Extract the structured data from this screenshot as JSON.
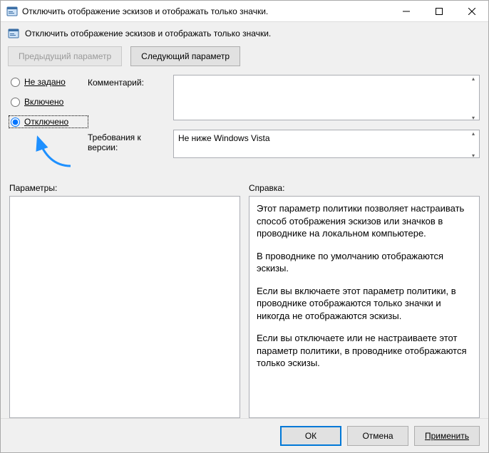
{
  "window": {
    "title": "Отключить отображение эскизов и отображать только значки."
  },
  "header": {
    "subtitle": "Отключить отображение эскизов и отображать только значки."
  },
  "nav": {
    "prev": "Предыдущий параметр",
    "next": "Следующий параметр"
  },
  "radios": {
    "not_configured": "Не задано",
    "enabled": "Включено",
    "disabled": "Отключено",
    "selected": "disabled"
  },
  "fields": {
    "comment_label": "Комментарий:",
    "comment_value": "",
    "requirements_label": "Требования к версии:",
    "requirements_value": "Не ниже Windows Vista"
  },
  "columns": {
    "options_label": "Параметры:",
    "help_label": "Справка:"
  },
  "help_paragraphs": [
    "Этот параметр политики позволяет настраивать способ отображения эскизов или значков в проводнике на локальном компьютере.",
    "В проводнике по умолчанию отображаются эскизы.",
    "Если вы включаете этот параметр политики, в проводнике отображаются только значки и никогда не отображаются эскизы.",
    "Если вы отключаете или не настраиваете этот параметр политики, в проводнике отображаются только эскизы."
  ],
  "footer": {
    "ok": "ОК",
    "cancel": "Отмена",
    "apply": "Применить"
  }
}
